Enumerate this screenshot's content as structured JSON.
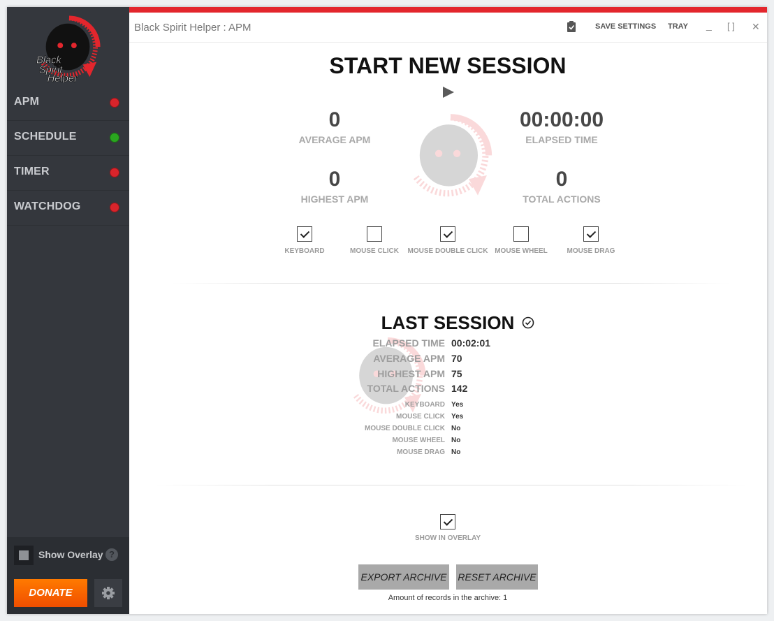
{
  "sidebar": {
    "logo_text": "Black Spirit Helper",
    "items": [
      {
        "label": "APM",
        "status_color": "#d9242b"
      },
      {
        "label": "SCHEDULE",
        "status_color": "#2aa61f"
      },
      {
        "label": "TIMER",
        "status_color": "#d9242b"
      },
      {
        "label": "WATCHDOG",
        "status_color": "#d9242b"
      }
    ],
    "show_overlay_label": "Show Overlay",
    "help_icon": "?",
    "donate_label": "DONATE",
    "settings_icon": "gear-icon"
  },
  "titlebar": {
    "title": "Black Spirit Helper : APM",
    "clipboard_icon": "clipboard-check-icon",
    "save_settings": "SAVE SETTINGS",
    "tray": "TRAY",
    "minimize": "_",
    "maximize": "[ ]",
    "close": "✕"
  },
  "session": {
    "title": "START NEW SESSION",
    "play_icon": "play-icon",
    "average_apm": {
      "value": "0",
      "label": "AVERAGE APM"
    },
    "elapsed_time": {
      "value": "00:00:00",
      "label": "ELAPSED TIME"
    },
    "highest_apm": {
      "value": "0",
      "label": "HIGHEST APM"
    },
    "total_actions": {
      "value": "0",
      "label": "TOTAL ACTIONS"
    },
    "options": [
      {
        "label": "KEYBOARD",
        "checked": true
      },
      {
        "label": "MOUSE CLICK",
        "checked": false
      },
      {
        "label": "MOUSE DOUBLE CLICK",
        "checked": true
      },
      {
        "label": "MOUSE WHEEL",
        "checked": false
      },
      {
        "label": "MOUSE DRAG",
        "checked": true
      }
    ]
  },
  "last_session": {
    "title": "LAST SESSION",
    "check_icon": "circle-check-icon",
    "stats": [
      {
        "label": "ELAPSED TIME",
        "value": "00:02:01"
      },
      {
        "label": "AVERAGE APM",
        "value": "70"
      },
      {
        "label": "HIGHEST APM",
        "value": "75"
      },
      {
        "label": "TOTAL ACTIONS",
        "value": "142"
      }
    ],
    "inputs": [
      {
        "label": "KEYBOARD",
        "value": "Yes"
      },
      {
        "label": "MOUSE CLICK",
        "value": "Yes"
      },
      {
        "label": "MOUSE DOUBLE CLICK",
        "value": "No"
      },
      {
        "label": "MOUSE WHEEL",
        "value": "No"
      },
      {
        "label": "MOUSE DRAG",
        "value": "No"
      }
    ]
  },
  "archive": {
    "show_in_overlay_label": "SHOW IN OVERLAY",
    "show_in_overlay_checked": true,
    "export_label": "EXPORT ARCHIVE",
    "reset_label": "RESET ARCHIVE",
    "records_text": "Amount of records in the archive: 1"
  }
}
